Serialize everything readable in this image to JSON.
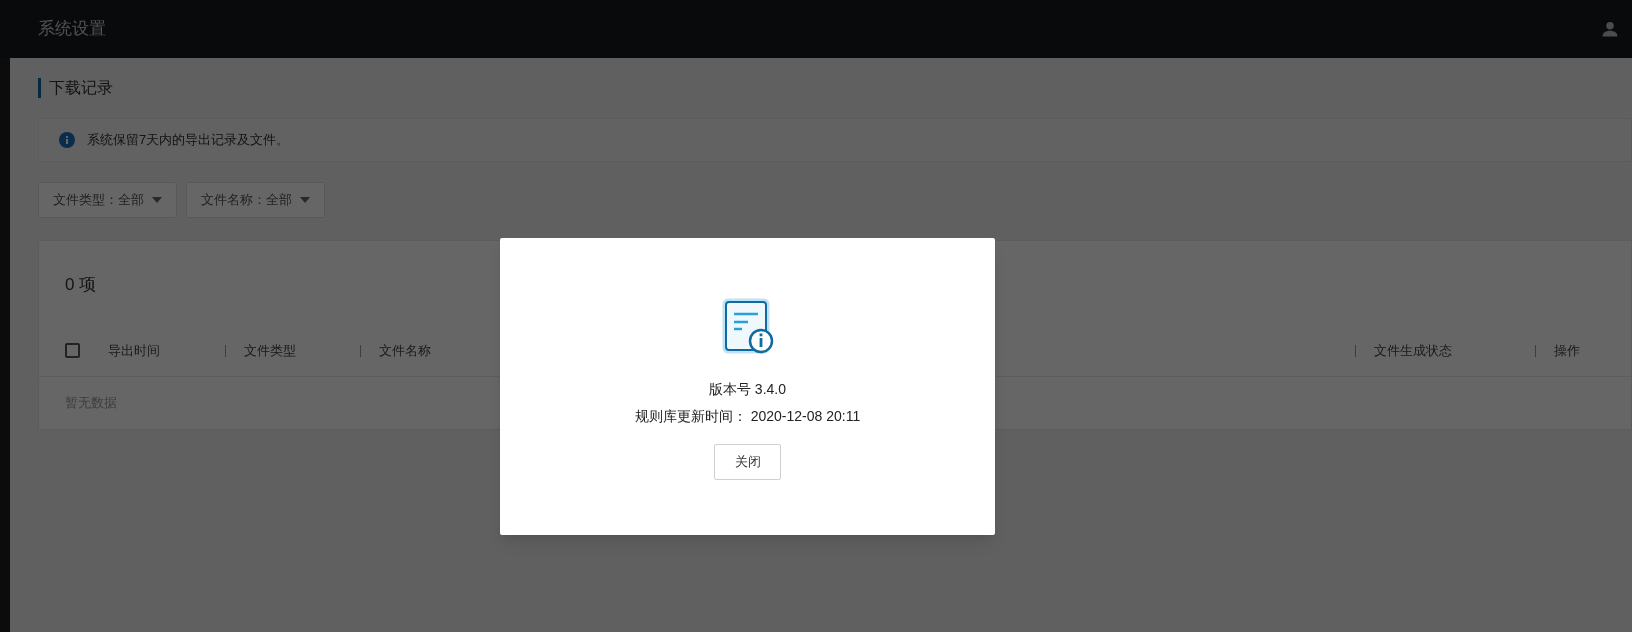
{
  "header": {
    "title": "系统设置"
  },
  "section": {
    "title": "下载记录"
  },
  "notice": {
    "text": "系统保留7天内的导出记录及文件。"
  },
  "filters": [
    {
      "label": "文件类型：",
      "value": "全部"
    },
    {
      "label": "文件名称：",
      "value": "全部"
    }
  ],
  "table": {
    "count": "0 项",
    "select_all": {
      "checked": false
    },
    "columns": [
      {
        "label": "导出时间"
      },
      {
        "label": "文件类型"
      },
      {
        "label": "文件名称"
      },
      {
        "label": "文件生成状态"
      },
      {
        "label": "操作"
      }
    ],
    "empty_text": "暂无数据"
  },
  "modal": {
    "version": "版本号 3.4.0",
    "update_time": "规则库更新时间： 2020-12-08 20:11",
    "button": "关闭"
  }
}
